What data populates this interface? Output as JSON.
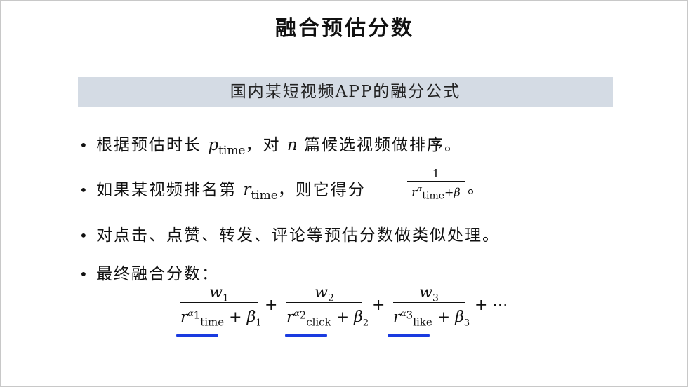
{
  "title": "融合预估分数",
  "banner": "国内某短视频APP的融分公式",
  "bullets": {
    "b1": {
      "pre": "根据预估时长 ",
      "var": "p",
      "sub": "time",
      "mid": "，对 ",
      "n": "n",
      "post": " 篇候选视频做排序。"
    },
    "b2": {
      "pre": "如果某视频排名第 ",
      "var": "r",
      "sub": "time",
      "post": "，则它得分 "
    },
    "b3": {
      "text": "对点击、点赞、转发、评论等预估分数做类似处理。"
    },
    "b4": {
      "text": "最终融合分数："
    }
  },
  "inline_fraction": {
    "numerator": "1",
    "den_var": "r",
    "den_sup": "α",
    "den_sub": "time",
    "den_rest": "+β",
    "period": "。"
  },
  "formula": {
    "terms": [
      {
        "w": "w",
        "w_sub": "1",
        "r": "r",
        "alpha": "α",
        "alpha_sub": "1",
        "r_sub": "time",
        "plus": "+",
        "beta": "β",
        "beta_sub": "1"
      },
      {
        "w": "w",
        "w_sub": "2",
        "r": "r",
        "alpha": "α",
        "alpha_sub": "2",
        "r_sub": "click",
        "plus": "+",
        "beta": "β",
        "beta_sub": "2"
      },
      {
        "w": "w",
        "w_sub": "3",
        "r": "r",
        "alpha": "α",
        "alpha_sub": "3",
        "r_sub": "like",
        "plus": "+",
        "beta": "β",
        "beta_sub": "3"
      }
    ],
    "op1": "+",
    "op2": "+",
    "tail": "+ ⋯"
  },
  "colors": {
    "banner_bg": "#d4dbe4",
    "underline": "#1a3be0"
  },
  "bullet_glyph": "•"
}
